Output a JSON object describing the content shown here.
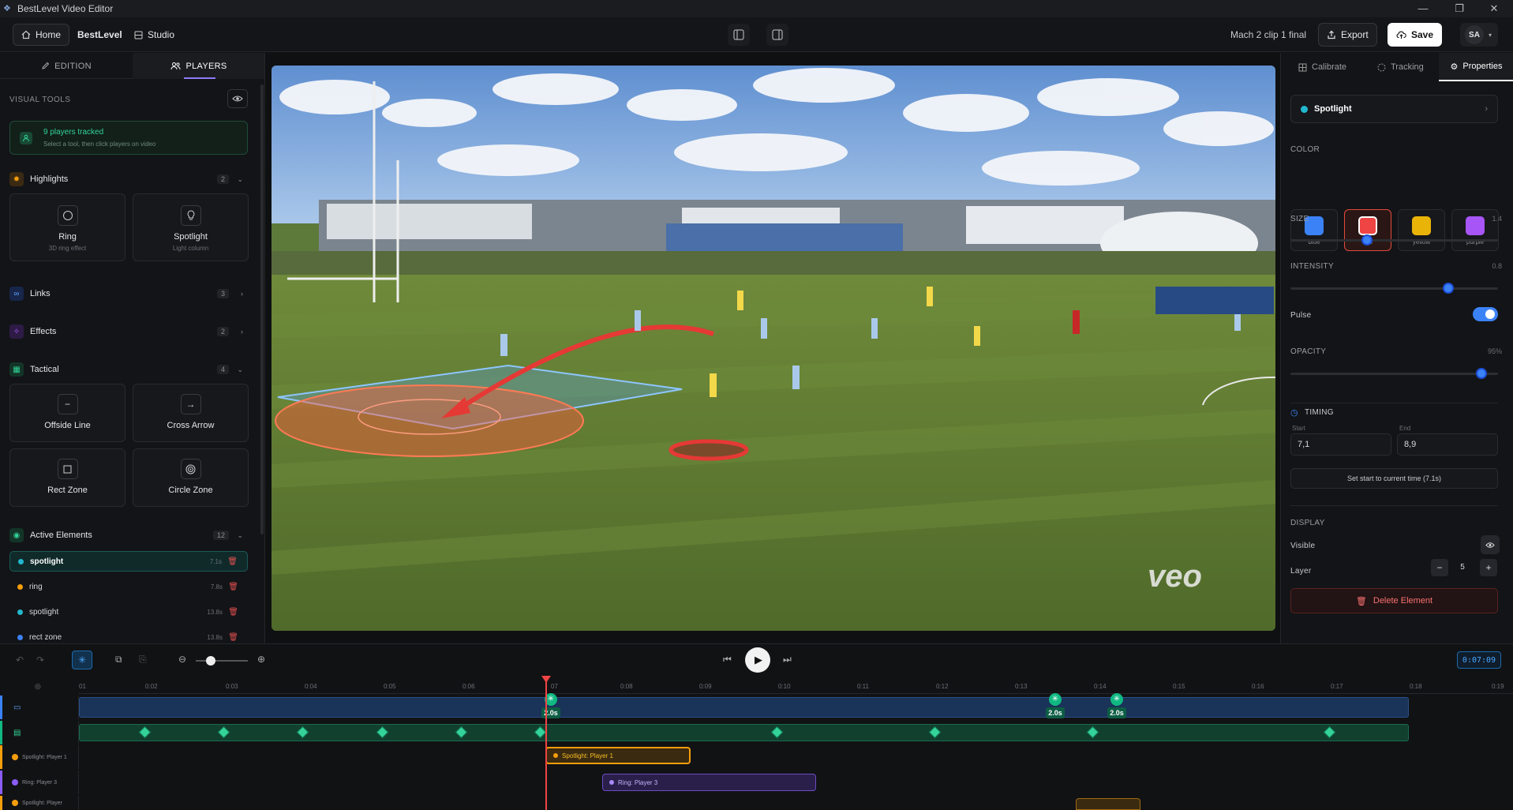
{
  "window": {
    "title": "BestLevel Video Editor"
  },
  "topbar": {
    "home_label": "Home",
    "brand": "BestLevel",
    "studio_label": "Studio",
    "project_name": "Mach 2 clip 1 final",
    "export_label": "Export",
    "save_label": "Save",
    "avatar": "SA"
  },
  "left_panel": {
    "tabs": [
      {
        "label": "EDITION"
      },
      {
        "label": "PLAYERS"
      }
    ],
    "visual_tools_label": "VISUAL TOOLS",
    "tracked": {
      "title": "9 players tracked",
      "subtitle": "Select a tool, then click players on video"
    },
    "groups": [
      {
        "label": "Highlights",
        "count": "2"
      },
      {
        "label": "Links",
        "count": "3"
      },
      {
        "label": "Effects",
        "count": "2"
      },
      {
        "label": "Tactical",
        "count": "4"
      },
      {
        "label": "Active Elements",
        "count": "12"
      }
    ],
    "highlight_tools": [
      {
        "label": "Ring",
        "sub": "3D ring effect"
      },
      {
        "label": "Spotlight",
        "sub": "Light column"
      }
    ],
    "tactical_tools": [
      {
        "label": "Offside Line"
      },
      {
        "label": "Cross Arrow"
      },
      {
        "label": "Rect Zone"
      },
      {
        "label": "Circle Zone"
      }
    ],
    "active_elements": [
      {
        "name": "spotlight",
        "time": "7.1s",
        "color": "#22b8cf"
      },
      {
        "name": "ring",
        "time": "7.8s",
        "color": "#f59e0b"
      },
      {
        "name": "spotlight",
        "time": "13.8s",
        "color": "#22b8cf"
      },
      {
        "name": "rect zone",
        "time": "13.8s",
        "color": "#3b82f6"
      }
    ]
  },
  "video": {
    "watermark": "veo"
  },
  "right_panel": {
    "tabs": [
      {
        "label": "Calibrate"
      },
      {
        "label": "Tracking"
      },
      {
        "label": "Properties"
      }
    ],
    "element_name": "Spotlight",
    "color_label": "COLOR",
    "colors": [
      {
        "name": "blue",
        "hex": "#3b82f6"
      },
      {
        "name": "red",
        "hex": "#ef4444"
      },
      {
        "name": "yellow",
        "hex": "#eab308"
      },
      {
        "name": "purple",
        "hex": "#a855f7"
      }
    ],
    "size": {
      "label": "SIZE",
      "value": "1.4",
      "level": 0.3
    },
    "intensity": {
      "label": "INTENSITY",
      "value": "0.8",
      "level": 0.78
    },
    "pulse_label": "Pulse",
    "opacity": {
      "label": "OPACITY",
      "value": "95%",
      "level": 0.95
    },
    "timing": {
      "label": "TIMING",
      "start_label": "Start",
      "end_label": "End",
      "start": "7,1",
      "end": "8,9",
      "set_start": "Set start to current time (7.1s)"
    },
    "display": {
      "label": "DISPLAY",
      "visible_label": "Visible",
      "layer_label": "Layer",
      "layer_value": "5",
      "minus": "−",
      "plus": "+"
    },
    "delete_label": "Delete Element"
  },
  "timeline": {
    "timecode": "0:07:09",
    "ticks": [
      "01",
      "0:02",
      "0:03",
      "0:04",
      "0:05",
      "0:06",
      "07",
      "0:08",
      "0:09",
      "0:10",
      "0:11",
      "0:12",
      "0:13",
      "0:14",
      "0:15",
      "0:16",
      "0:17",
      "0:18",
      "0:19"
    ],
    "keyframe_label": "2.0s",
    "tracks": [
      {
        "label": "Spotlight: Player 1",
        "color": "#f59e0b"
      },
      {
        "label": "Ring: Player 3",
        "color": "#8b5cf6"
      },
      {
        "label": "Spotlight: Player",
        "color": "#f59e0b"
      }
    ],
    "clips": [
      {
        "label": "Spotlight: Player 1"
      },
      {
        "label": "Ring: Player 3"
      }
    ]
  }
}
